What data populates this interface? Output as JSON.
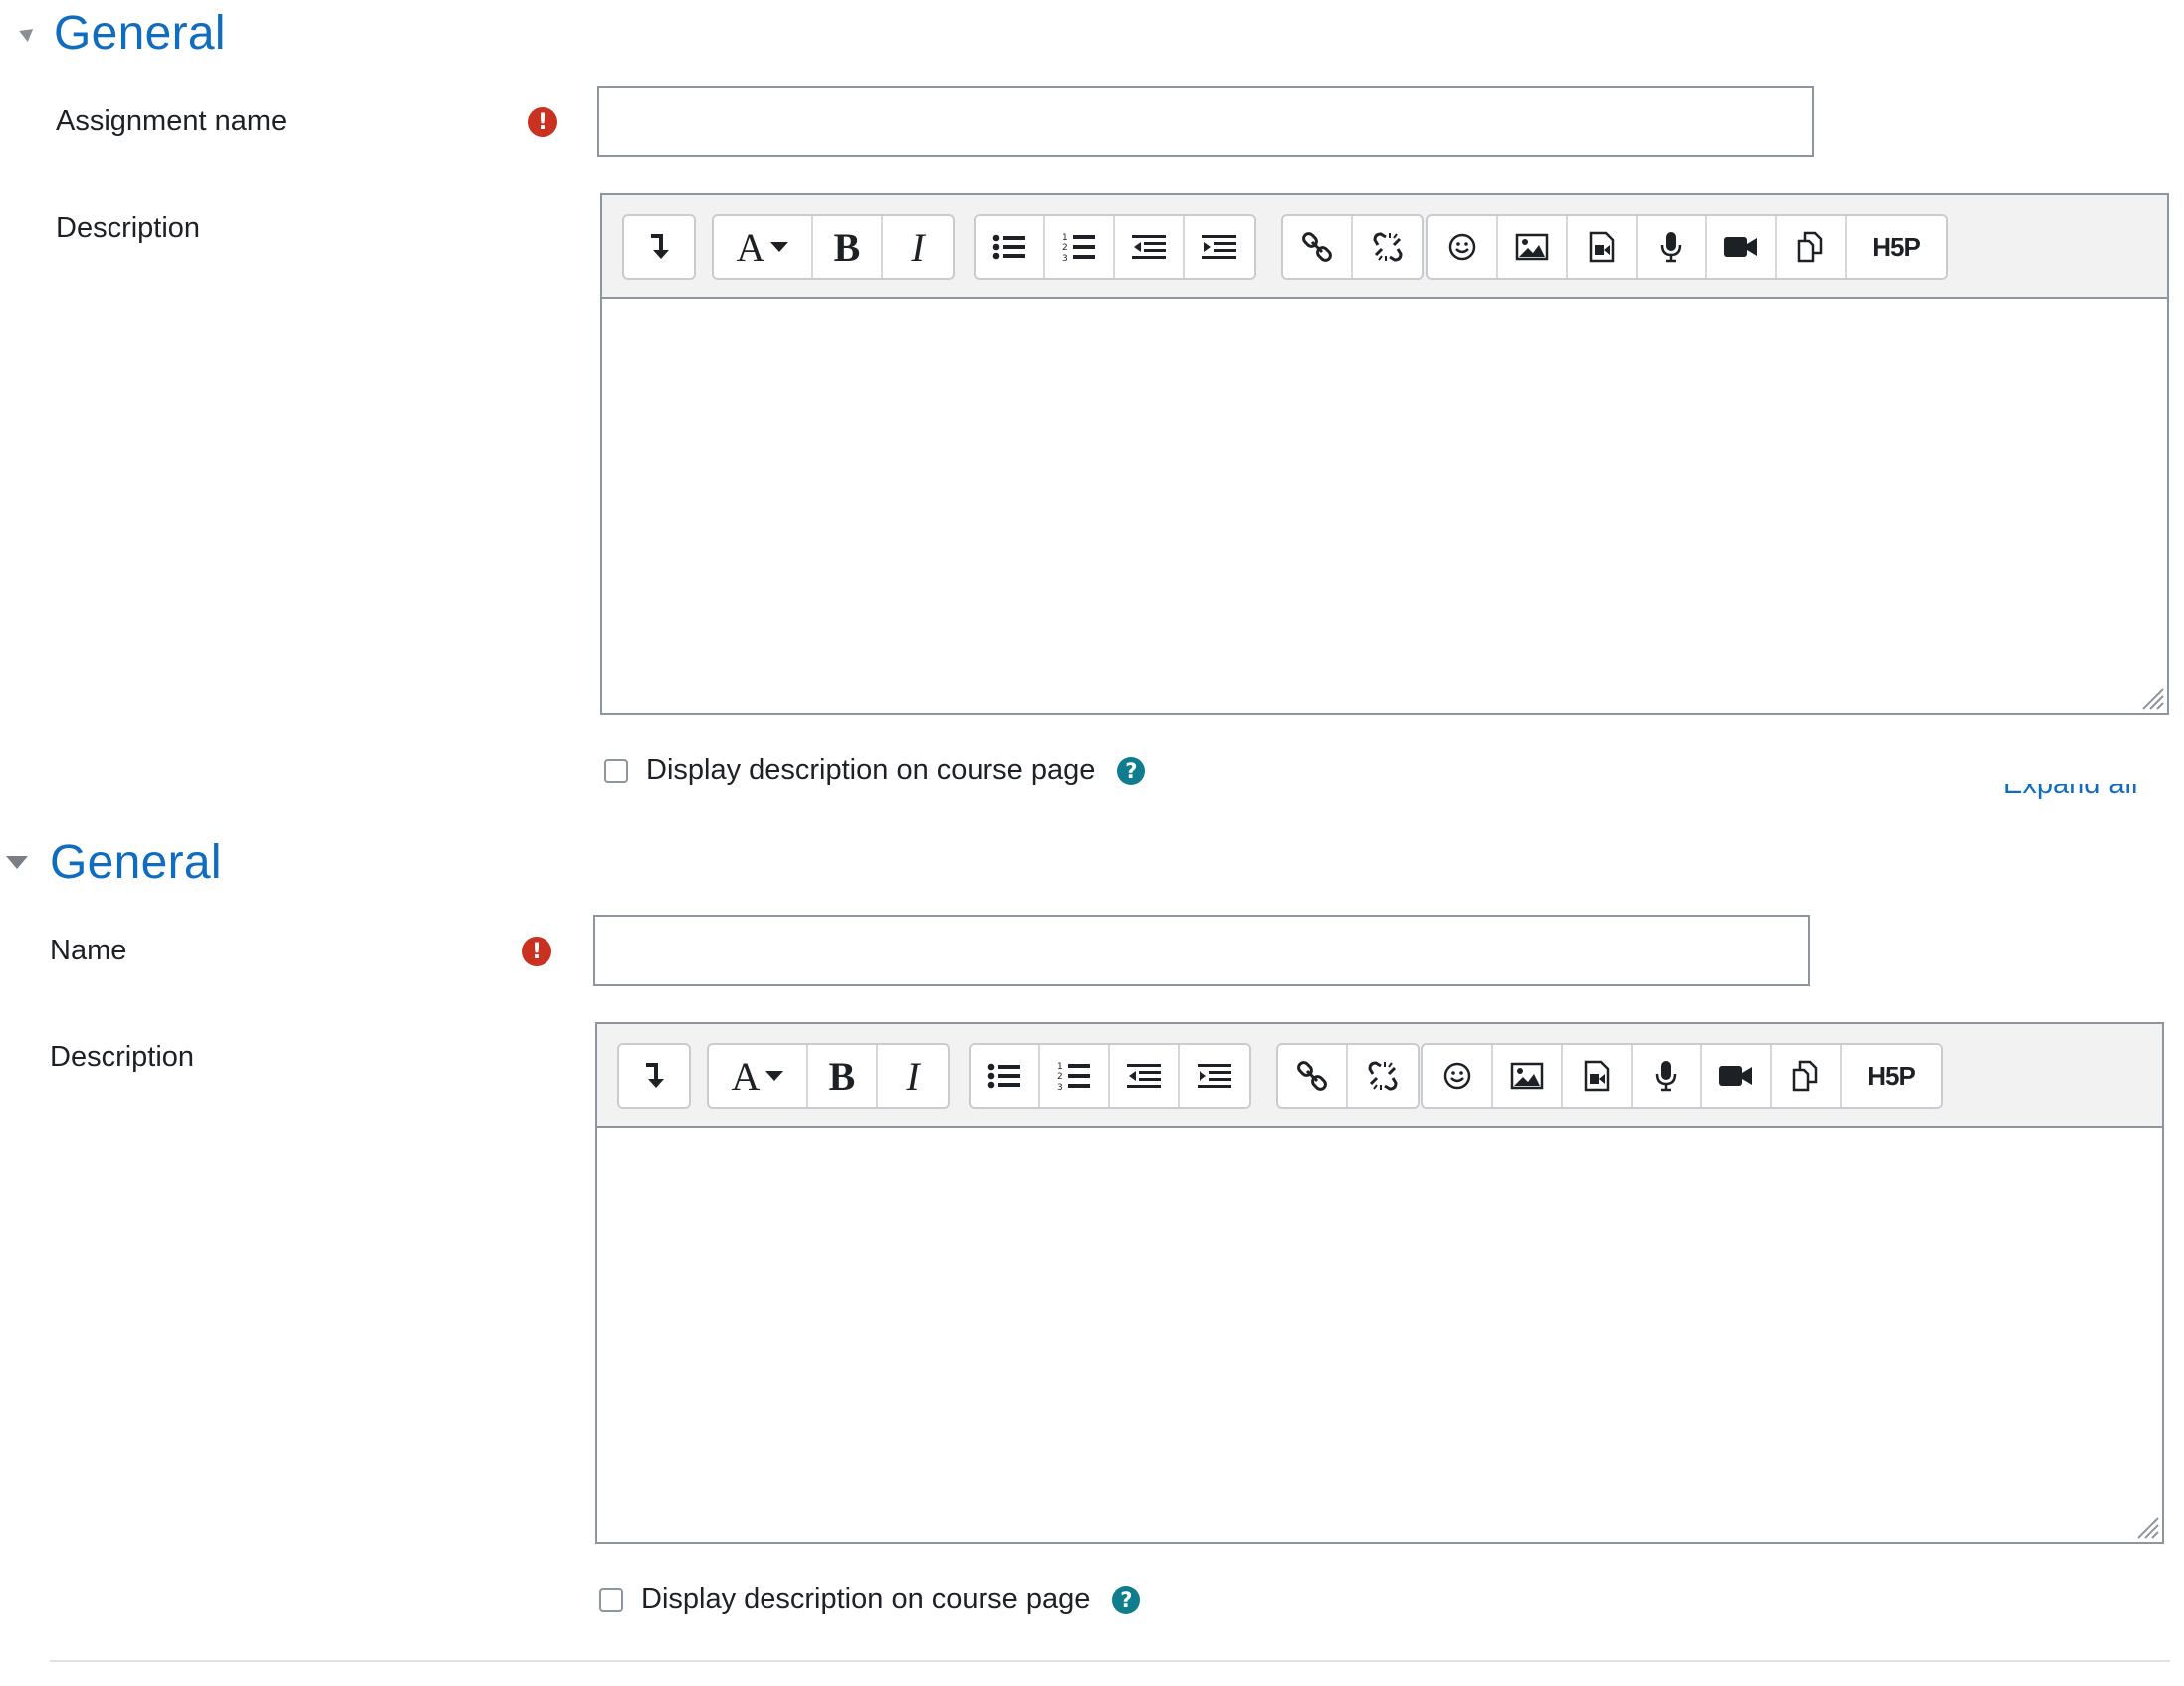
{
  "sections": [
    {
      "title": "General",
      "name_label": "Assignment name",
      "name_value": "",
      "description_label": "Description",
      "display_checkbox_label": "Display description on course page",
      "display_checked": false
    },
    {
      "title": "General",
      "name_label": "Name",
      "name_value": "",
      "description_label": "Description",
      "display_checkbox_label": "Display description on course page",
      "display_checked": false
    }
  ],
  "toolbar": {
    "groups": [
      [
        "show-more-buttons-icon"
      ],
      [
        "paragraph-styles-icon",
        "bold-icon",
        "italic-icon"
      ],
      [
        "unordered-list-icon",
        "ordered-list-icon",
        "outdent-icon",
        "indent-icon"
      ],
      [
        "link-icon",
        "unlink-icon"
      ],
      [
        "emoji-icon",
        "image-icon",
        "media-icon",
        "record-audio-icon",
        "record-video-icon",
        "manage-files-icon",
        "h5p-icon"
      ]
    ],
    "paragraph_glyph": "A",
    "bold_glyph": "B",
    "italic_glyph": "I",
    "h5p_glyph": "H5P"
  },
  "expand_all_label": "Expand all",
  "required_glyph": "!",
  "help_glyph": "?",
  "colors": {
    "accent": "#0f6cbf",
    "required": "#ca3120",
    "help": "#0f7d8e",
    "toolbar_bg": "#f2f2f2"
  }
}
